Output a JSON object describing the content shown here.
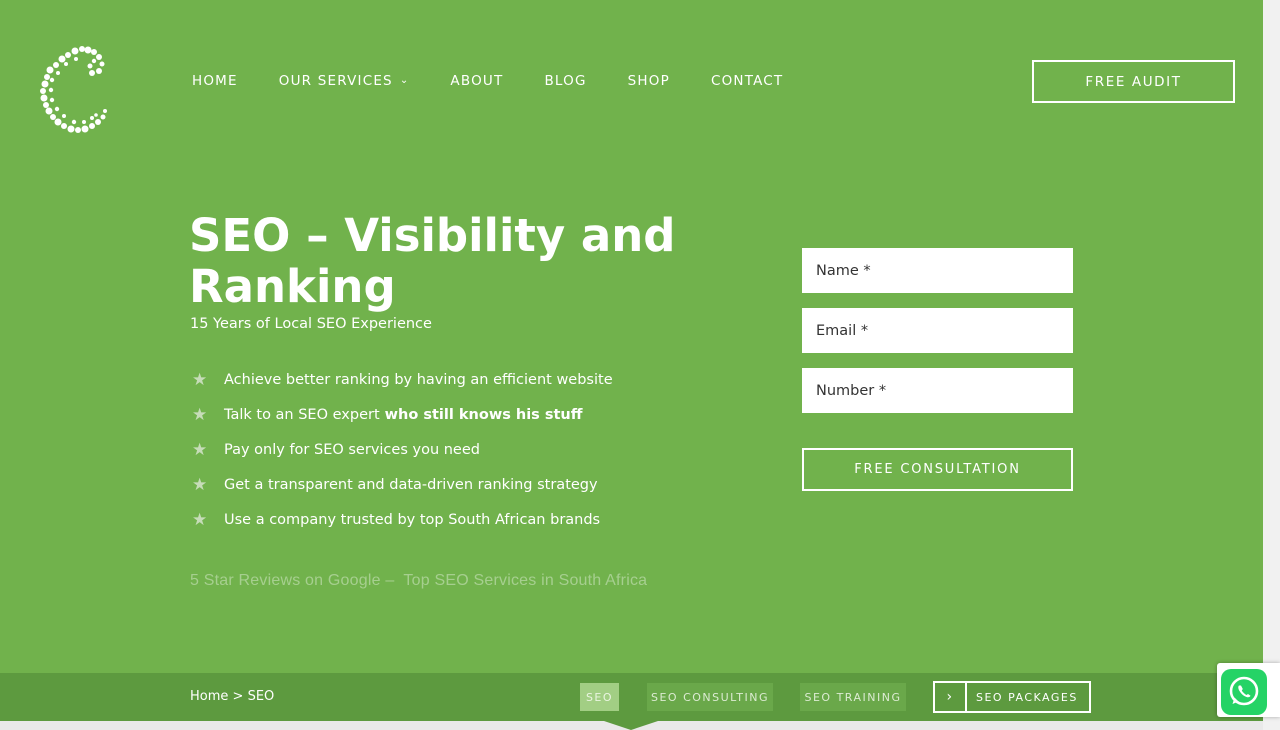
{
  "nav": {
    "items": [
      {
        "label": "HOME"
      },
      {
        "label": "OUR SERVICES",
        "has_dropdown": true
      },
      {
        "label": "ABOUT"
      },
      {
        "label": "BLOG"
      },
      {
        "label": "SHOP"
      },
      {
        "label": "CONTACT"
      }
    ],
    "dropdown_icon": "chevron-down-icon",
    "cta_label": "FREE AUDIT"
  },
  "hero": {
    "title": "SEO – Visibility and Ranking",
    "subtitle": "15 Years of Local SEO Experience",
    "features": [
      {
        "text": "Achieve better ranking by having an efficient website",
        "bold": ""
      },
      {
        "text": "Talk to an SEO expert",
        "bold": "who still knows his stuff"
      },
      {
        "text": "Pay only for SEO services you need",
        "bold": ""
      },
      {
        "text": "Get a transparent and data-driven ranking strategy",
        "bold": ""
      },
      {
        "text": "Use a company trusted by top South African brands",
        "bold": ""
      }
    ],
    "feature_icon": "star-icon",
    "reviews_text": "5 Star Reviews on Google –  Top SEO Services in South Africa"
  },
  "form": {
    "name_placeholder": "Name *",
    "email_placeholder": "Email *",
    "number_placeholder": "Number *",
    "submit_label": "FREE CONSULTATION"
  },
  "subnav": {
    "breadcrumb_home": "Home",
    "breadcrumb_sep": ">",
    "breadcrumb_current": "SEO",
    "tabs": [
      {
        "label": "SEO",
        "active": true
      },
      {
        "label": "SEO CONSULTING"
      },
      {
        "label": "SEO TRAINING"
      },
      {
        "label": "SEO PACKAGES",
        "icon": "chevron-right-icon"
      }
    ]
  },
  "colors": {
    "hero_bg": "#71b24c",
    "subbar_bg": "#5d9a3f",
    "whatsapp": "#25d366"
  },
  "floating": {
    "icon": "whatsapp-icon"
  }
}
